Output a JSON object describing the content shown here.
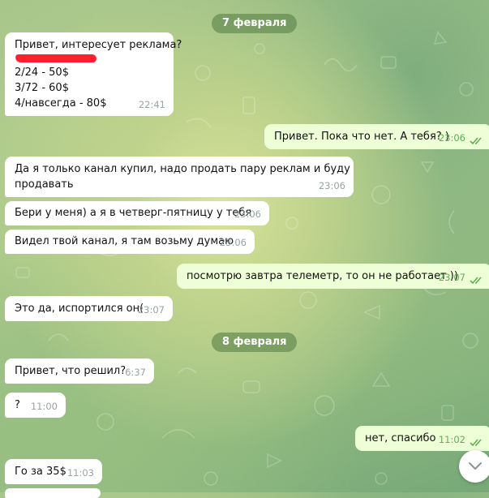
{
  "chat": {
    "dates": [
      "7 февраля",
      "8 февраля"
    ],
    "messages": [
      {
        "dir": "in",
        "lines": [
          "Привет, интересует реклама?",
          "2/24 - 50$",
          "3/72 - 60$",
          "4/навсегда - 80$"
        ],
        "redacted_line": true,
        "time": "22:41"
      },
      {
        "dir": "out",
        "text": "Привет. Пока что нет. А тебя? )",
        "time": "23:06",
        "read": true
      },
      {
        "dir": "in",
        "lines": [
          "Да я только канал купил, надо продать пару реклам и буду",
          "продавать"
        ],
        "time": "23:06"
      },
      {
        "dir": "in",
        "text": "Бери у меня) а я в четверг-пятницу у тебя",
        "time": "23:06"
      },
      {
        "dir": "in",
        "text": "Видел твой канал, я там возьму думаю",
        "time": "23:06"
      },
      {
        "dir": "out",
        "text": "посмотрю завтра телеметр, то он не работает ))",
        "time": "23:07",
        "read": true
      },
      {
        "dir": "in",
        "text": "Это да, испортился он(",
        "time": "23:07"
      },
      {
        "dir": "in",
        "text": "Привет, что решил?",
        "time": "6:37"
      },
      {
        "dir": "in",
        "text": "?",
        "time": "11:00"
      },
      {
        "dir": "out",
        "text": "нет, спасибо",
        "time": "11:02",
        "read": true
      },
      {
        "dir": "in",
        "text": "Го за 35$",
        "time": "11:03"
      }
    ]
  },
  "colors": {
    "incoming_bubble": "#ffffff",
    "outgoing_bubble": "#eefed7",
    "outgoing_time": "#62ac55",
    "date_pill": "#5a824b",
    "redaction": "#ff1f2d"
  },
  "icons": {
    "read_status": "double-check-icon",
    "scroll_down": "chevron-down-icon",
    "background": "doodle-pattern"
  }
}
